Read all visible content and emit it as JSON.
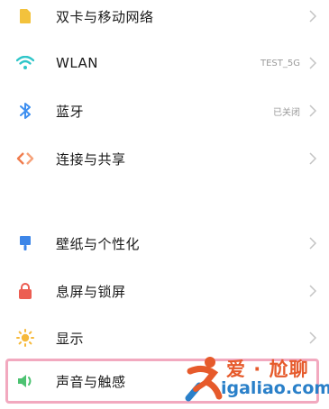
{
  "settings": {
    "items": [
      {
        "label": "双卡与移动网络",
        "value": "",
        "icon": "sim-card-icon"
      },
      {
        "label": "WLAN",
        "value": "TEST_5G",
        "icon": "wifi-icon"
      },
      {
        "label": "蓝牙",
        "value": "已关闭",
        "icon": "bluetooth-icon"
      },
      {
        "label": "连接与共享",
        "value": "",
        "icon": "connection-share-icon"
      },
      {
        "label": "壁纸与个性化",
        "value": "",
        "icon": "wallpaper-icon"
      },
      {
        "label": "息屏与锁屏",
        "value": "",
        "icon": "lock-icon"
      },
      {
        "label": "显示",
        "value": "",
        "icon": "brightness-icon"
      },
      {
        "label": "声音与触感",
        "value": "",
        "icon": "sound-icon"
      }
    ]
  },
  "watermark": {
    "title": "爱 · 尬聊",
    "domain": "igaliao.com"
  },
  "colors": {
    "sim": "#f3c23c",
    "wifi": "#2fc6c9",
    "bluetooth": "#3e8ff0",
    "share": "#f07c4d",
    "wallpaper": "#3d86e8",
    "lock": "#ec5d52",
    "display": "#f6b93b",
    "sound": "#4cc271",
    "highlight": "#f2a9bf"
  }
}
